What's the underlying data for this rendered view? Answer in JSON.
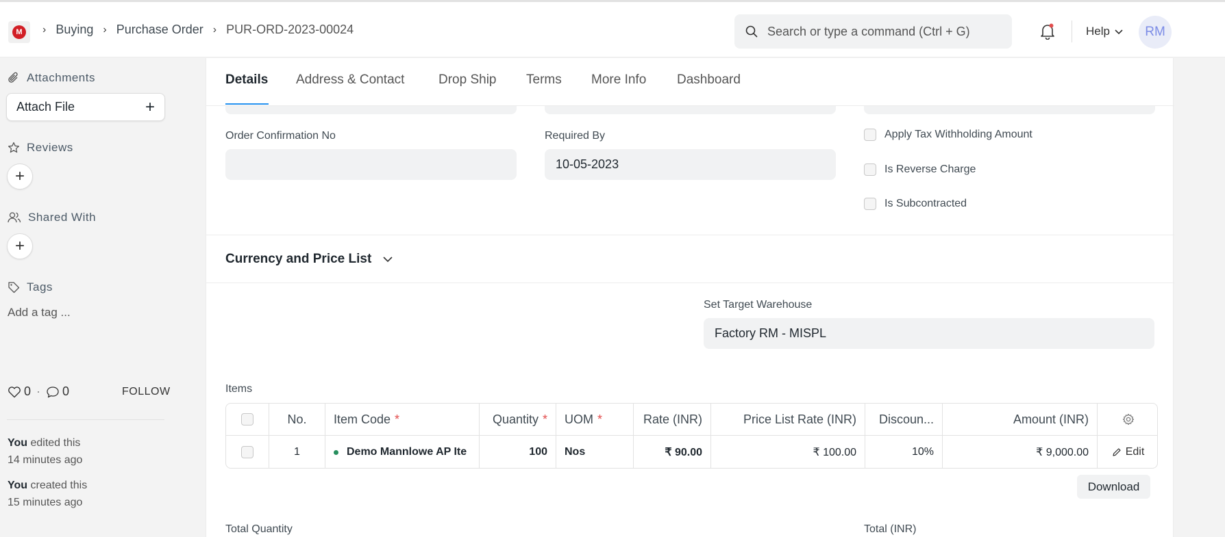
{
  "header": {
    "logo_text": "M",
    "breadcrumbs": [
      "Buying",
      "Purchase Order",
      "PUR-ORD-2023-00024"
    ],
    "search_placeholder": "Search or type a command (Ctrl + G)",
    "help_label": "Help",
    "avatar_initials": "RM"
  },
  "sidebar": {
    "attachments_label": "Attachments",
    "attach_file_label": "Attach File",
    "reviews_label": "Reviews",
    "shared_with_label": "Shared With",
    "tags_label": "Tags",
    "add_tag_label": "Add a tag ...",
    "likes_count": "0",
    "comments_count": "0",
    "follow_label": "FOLLOW",
    "activity": [
      {
        "who": "You",
        "action": "edited this",
        "when": "14 minutes ago"
      },
      {
        "who": "You",
        "action": "created this",
        "when": "15 minutes ago"
      }
    ]
  },
  "tabs": [
    "Details",
    "Address & Contact",
    "Drop Ship",
    "Terms",
    "More Info",
    "Dashboard"
  ],
  "form": {
    "order_confirmation_label": "Order Confirmation No",
    "order_confirmation_value": "",
    "required_by_label": "Required By",
    "required_by_value": "10-05-2023",
    "checkboxes": [
      "Apply Tax Withholding Amount",
      "Is Reverse Charge",
      "Is Subcontracted"
    ],
    "section_title": "Currency and Price List",
    "target_warehouse_label": "Set Target Warehouse",
    "target_warehouse_value": "Factory RM - MISPL",
    "items_label": "Items",
    "total_quantity_label": "Total Quantity",
    "total_label": "Total (INR)"
  },
  "items_table": {
    "headers": {
      "no": "No.",
      "item_code": "Item Code",
      "quantity": "Quantity",
      "uom": "UOM",
      "rate": "Rate (INR)",
      "price_list_rate": "Price List Rate (INR)",
      "discount": "Discoun...",
      "amount": "Amount (INR)",
      "required_mark": "*"
    },
    "rows": [
      {
        "no": "1",
        "item_code": "Demo Mannlowe AP Ite",
        "quantity": "100",
        "uom": "Nos",
        "rate": "₹ 90.00",
        "price_list_rate": "₹ 100.00",
        "discount": "10%",
        "amount": "₹ 9,000.00",
        "edit_label": "Edit"
      }
    ],
    "download_label": "Download"
  }
}
